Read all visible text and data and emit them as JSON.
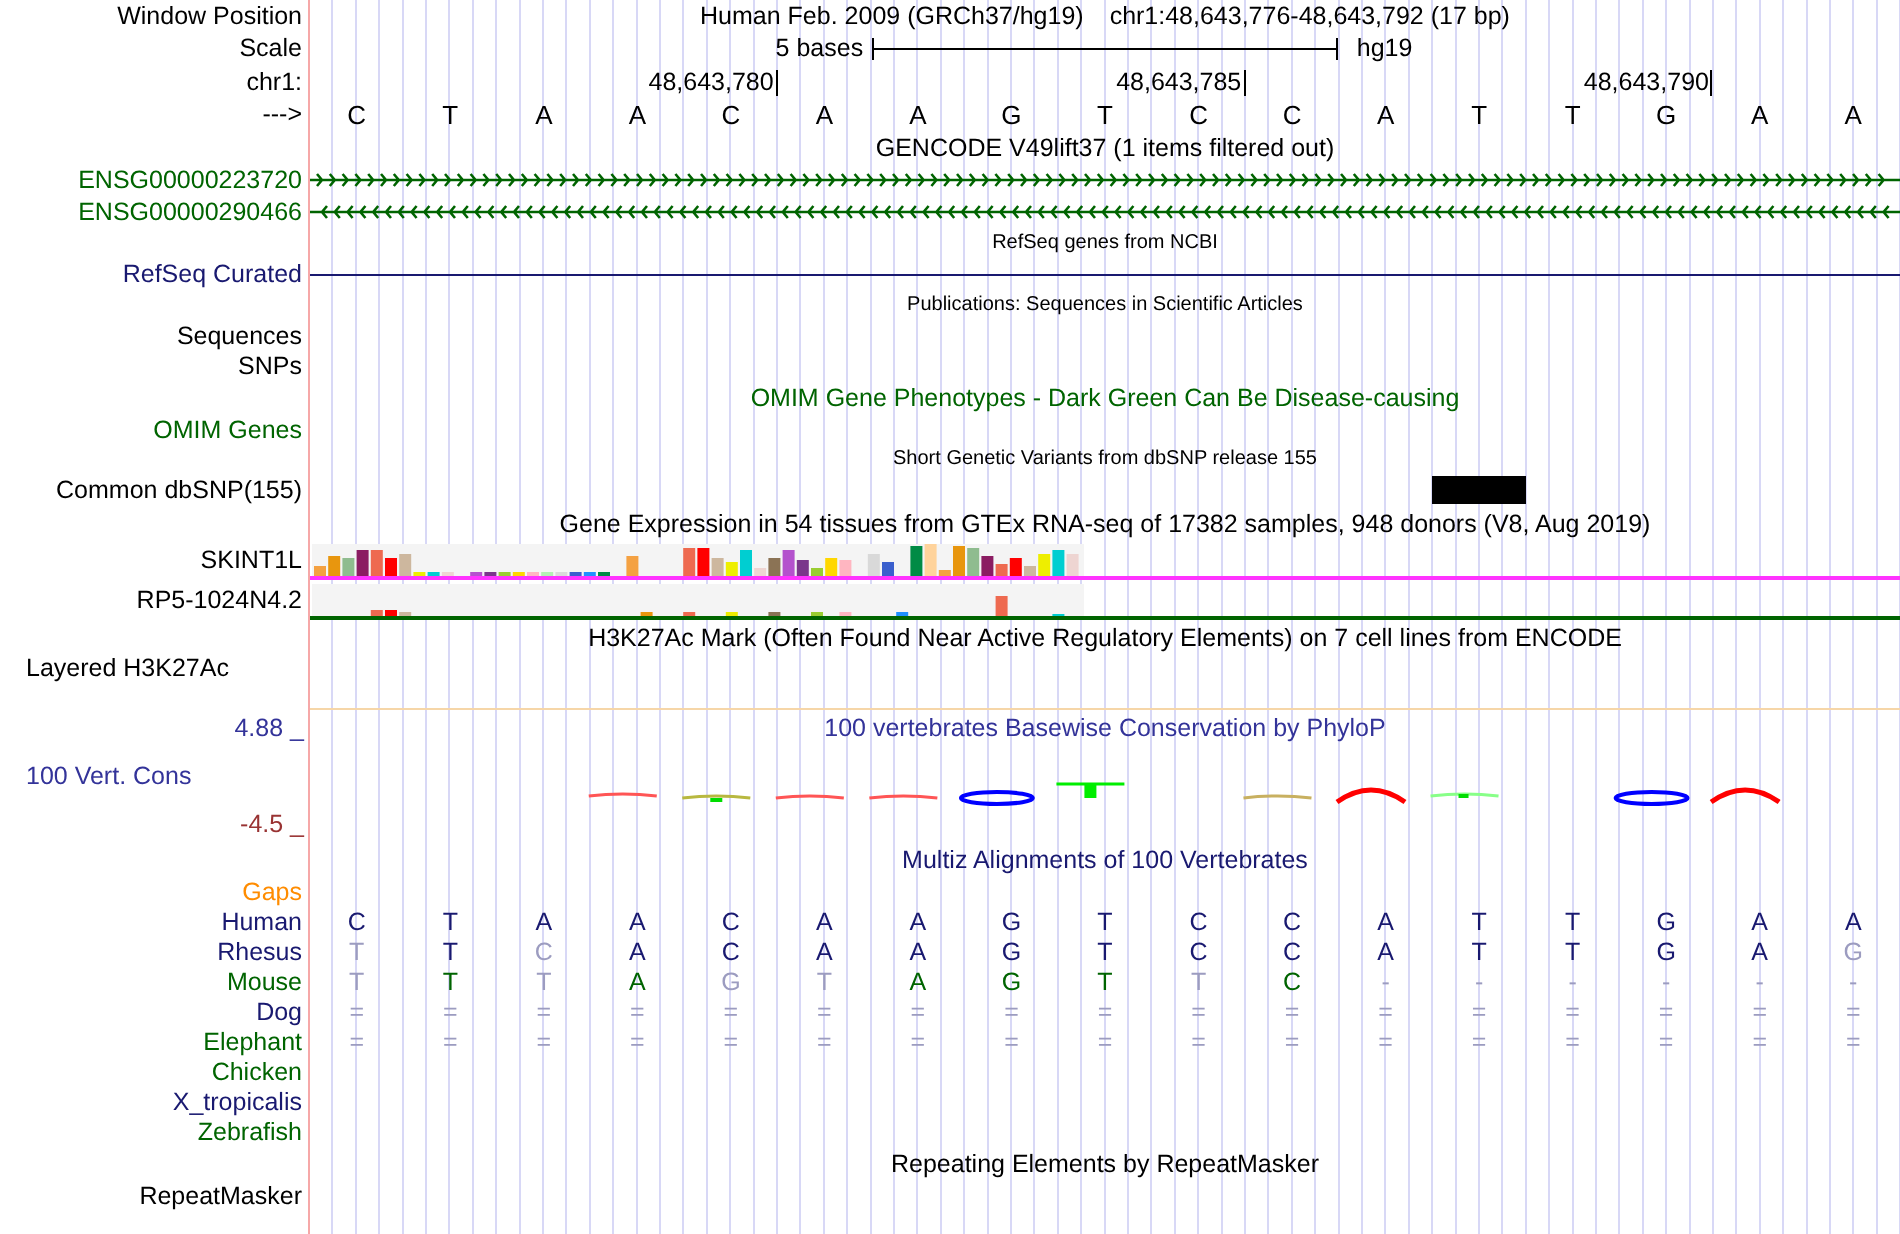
{
  "header": {
    "label": "Window Position",
    "title": "Human Feb. 2009 (GRCh37/hg19)",
    "position": "chr1:48,643,776-48,643,792 (17 bp)"
  },
  "scale": {
    "label": "Scale",
    "ruler": "5 bases",
    "assembly": "hg19"
  },
  "coordinates": {
    "label": "chr1:",
    "ticks": [
      "48,643,780",
      "48,643,785",
      "48,643,790"
    ]
  },
  "sequence": {
    "label": "--->",
    "bases": [
      {
        "base": "C",
        "common_snp": false
      },
      {
        "base": "T",
        "common_snp": false
      },
      {
        "base": "A",
        "common_snp": false
      },
      {
        "base": "A",
        "common_snp": false
      },
      {
        "base": "C",
        "common_snp": false
      },
      {
        "base": "A",
        "common_snp": false
      },
      {
        "base": "A",
        "common_snp": false
      },
      {
        "base": "G",
        "common_snp": false
      },
      {
        "base": "T",
        "common_snp": false
      },
      {
        "base": "C",
        "common_snp": false
      },
      {
        "base": "C",
        "common_snp": false
      },
      {
        "base": "A",
        "common_snp": false
      },
      {
        "base": "T",
        "common_snp": true
      },
      {
        "base": "T",
        "common_snp": false
      },
      {
        "base": "G",
        "common_snp": false
      },
      {
        "base": "A",
        "common_snp": false
      },
      {
        "base": "A",
        "common_snp": false
      }
    ]
  },
  "tracks": [
    {
      "kind": "title",
      "text": "GENCODE V49lift37 (1 items filtered out)",
      "color": "#000000"
    },
    {
      "kind": "gene",
      "label": "ENSG00000223720",
      "color": "#006400",
      "reverse": false
    },
    {
      "kind": "gene",
      "label": "ENSG00000290466",
      "color": "#006400",
      "reverse": true
    },
    {
      "kind": "small_title",
      "text": "RefSeq genes from NCBI"
    },
    {
      "kind": "line",
      "label": "RefSeq Curated",
      "color": "#191970",
      "line": {
        "color": "#191970"
      }
    },
    {
      "kind": "small_title",
      "text": "Publications: Sequences in Scientific Articles"
    },
    {
      "kind": "label",
      "label": "Sequences",
      "color": "#000000"
    },
    {
      "kind": "label",
      "label": "SNPs",
      "color": "#000000"
    },
    {
      "kind": "title",
      "text": "OMIM Gene Phenotypes - Dark Green Can Be Disease-causing",
      "color": "#006400"
    },
    {
      "kind": "label",
      "label": "OMIM Genes",
      "color": "#006400"
    },
    {
      "kind": "small_title",
      "text": "Short Genetic Variants from dbSNP release 155"
    },
    {
      "kind": "variant",
      "label": "Common dbSNP(155)",
      "color": "#000000"
    },
    {
      "kind": "title",
      "text": "Gene Expression in 54 tissues from GTEx RNA-seq of 17382 samples, 948 donors (V8, Aug 2019)",
      "color": "#000000"
    },
    {
      "kind": "expression",
      "label": "SKINT1L",
      "color": "#000000",
      "line": {
        "color": "#ff33ff"
      }
    },
    {
      "kind": "expression",
      "label": "RP5-1024N4.2",
      "color": "#000000",
      "line": {
        "color": "#006400"
      }
    },
    {
      "kind": "title",
      "text": "H3K27Ac Mark (Often Found Near Active Regulatory Elements) on 7 cell lines from ENCODE",
      "color": "#000000"
    },
    {
      "kind": "layered",
      "label": "Layered H3K27Ac",
      "color": "#000000"
    },
    {
      "kind": "conservation",
      "label": "100 Vert. Cons",
      "title": "100 vertebrates Basewise Conservation by PhyloP",
      "max": "4.88 _",
      "min": "-4.5 _"
    },
    {
      "kind": "title",
      "text": "Multiz Alignments of 100 Vertebrates",
      "color": "#191970"
    },
    {
      "kind": "species",
      "label": "Gaps",
      "color": "#ff8c00"
    },
    {
      "kind": "species",
      "label": "Human",
      "color": "#191970",
      "bases": [
        "C",
        "T",
        "A",
        "A",
        "C",
        "A",
        "A",
        "G",
        "T",
        "C",
        "C",
        "A",
        "T",
        "T",
        "G",
        "A",
        "A"
      ],
      "matches": [
        true,
        true,
        true,
        true,
        true,
        true,
        true,
        true,
        true,
        true,
        true,
        true,
        true,
        true,
        true,
        true,
        true
      ]
    },
    {
      "kind": "species",
      "label": "Rhesus",
      "color": "#191970",
      "bases": [
        "T",
        "T",
        "C",
        "A",
        "C",
        "A",
        "A",
        "G",
        "T",
        "C",
        "C",
        "A",
        "T",
        "T",
        "G",
        "A",
        "G"
      ],
      "matches": [
        false,
        true,
        false,
        true,
        true,
        true,
        true,
        true,
        true,
        true,
        true,
        true,
        true,
        true,
        true,
        true,
        false
      ]
    },
    {
      "kind": "species",
      "label": "Mouse",
      "color": "#006400",
      "bases": [
        "T",
        "T",
        "T",
        "A",
        "G",
        "T",
        "A",
        "G",
        "T",
        "T",
        "C",
        "-",
        "-",
        "-",
        "-",
        "-",
        "-"
      ],
      "matches": [
        false,
        true,
        false,
        true,
        false,
        false,
        true,
        true,
        true,
        false,
        true,
        false,
        false,
        false,
        false,
        false,
        false
      ]
    },
    {
      "kind": "species",
      "label": "Dog",
      "color": "#191970",
      "bases": [
        "=",
        "=",
        "=",
        "=",
        "=",
        "=",
        "=",
        "=",
        "=",
        "=",
        "=",
        "=",
        "=",
        "=",
        "=",
        "=",
        "="
      ],
      "matches": [
        false,
        false,
        false,
        false,
        false,
        false,
        false,
        false,
        false,
        false,
        false,
        false,
        false,
        false,
        false,
        false,
        false
      ]
    },
    {
      "kind": "species",
      "label": "Elephant",
      "color": "#006400",
      "bases": [
        "=",
        "=",
        "=",
        "=",
        "=",
        "=",
        "=",
        "=",
        "=",
        "=",
        "=",
        "=",
        "=",
        "=",
        "=",
        "=",
        "="
      ],
      "matches": [
        false,
        false,
        false,
        false,
        false,
        false,
        false,
        false,
        false,
        false,
        false,
        false,
        false,
        false,
        false,
        false,
        false
      ]
    },
    {
      "kind": "species",
      "label": "Chicken",
      "color": "#006400"
    },
    {
      "kind": "species",
      "label": "X_tropicalis",
      "color": "#191970"
    },
    {
      "kind": "species",
      "label": "Zebrafish",
      "color": "#006400"
    },
    {
      "kind": "title",
      "text": "Repeating Elements by RepeatMasker",
      "color": "#000000"
    },
    {
      "kind": "label",
      "label": "RepeatMasker",
      "color": "#000000"
    }
  ]
}
